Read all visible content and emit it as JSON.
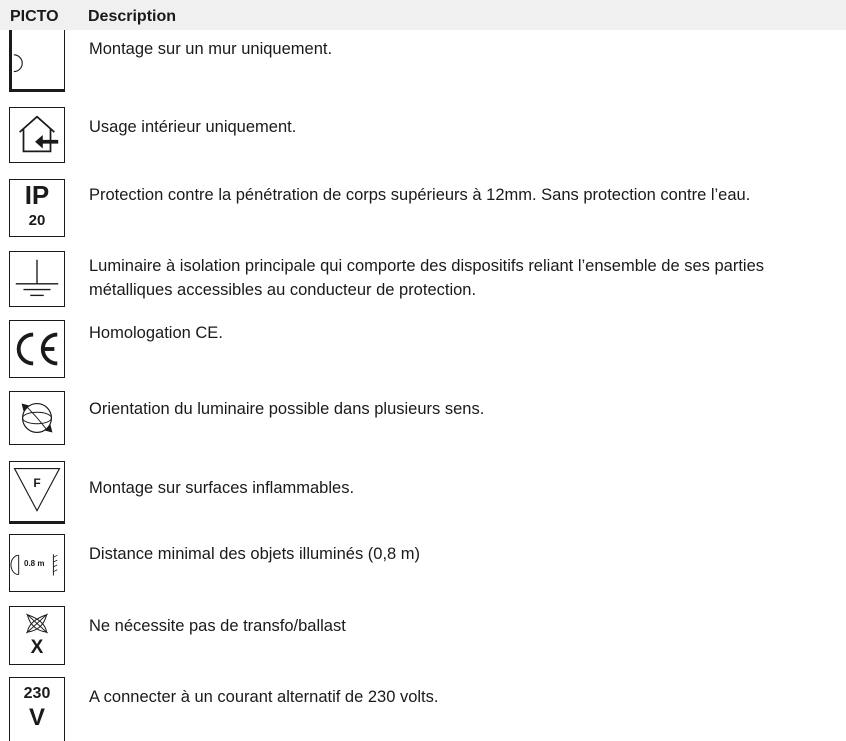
{
  "table": {
    "header": {
      "picto": "PICTO",
      "description": "Description"
    },
    "rows": [
      {
        "icon": "wall-mount-icon",
        "text": "Montage sur un mur uniquement."
      },
      {
        "icon": "indoor-use-icon",
        "text": "Usage intérieur uniquement."
      },
      {
        "icon": "ip20-icon",
        "icon_text_top": "IP",
        "icon_text_bottom": "20",
        "text": "Protection contre la pénétration de corps supérieurs à 12mm. Sans protection contre l’eau."
      },
      {
        "icon": "earth-ground-icon",
        "text": "Luminaire à isolation principale qui comporte des dispositifs reliant l’ensemble de ses parties métalliques accessibles au conducteur de protection."
      },
      {
        "icon": "ce-mark-icon",
        "text": "Homologation CE."
      },
      {
        "icon": "orientation-icon",
        "text": "Orientation du luminaire possible dans plusieurs sens."
      },
      {
        "icon": "flammable-surface-icon",
        "icon_text": "F",
        "text": "Montage sur surfaces inflammables."
      },
      {
        "icon": "distance-icon",
        "icon_text": "0.8 m",
        "text": "Distance minimal des objets illuminés (0,8 m)"
      },
      {
        "icon": "no-transformer-icon",
        "icon_text": "X",
        "text": "Ne nécessite pas de transfo/ballast"
      },
      {
        "icon": "voltage-icon",
        "icon_text_top": "230",
        "icon_text_bottom": "V",
        "text": "A connecter à un courant alternatif de 230 volts."
      }
    ]
  }
}
